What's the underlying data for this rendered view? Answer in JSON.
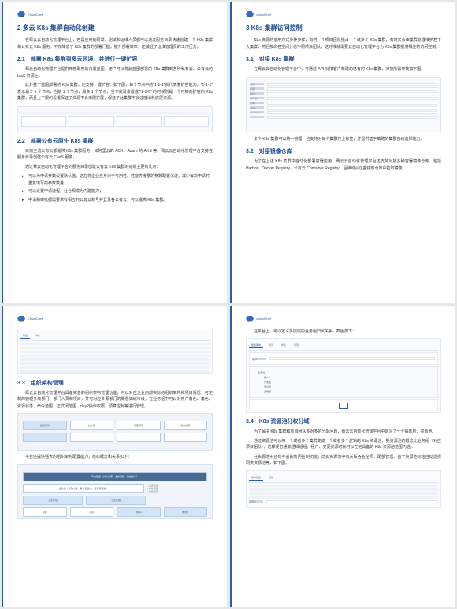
{
  "brand": "CloudChef",
  "page1": {
    "h1": "2 多云 K8s 集群自动化创建",
    "p1": "在骞云云自动化管理平台上，容器应用的研发、测试和运维人员都可以通过服务目录快速创建一个 K8s 集群和公有云 K8s 服务。不仅降低了 K8s 集群的部署门槛，提升部署效率，还减轻了运维管理员的工作压力。",
    "h2a": "2.1　部署 K8s 集群到多云环境，并进行一键扩容",
    "p2": "骞云自动化管理平台提供开箱即用的内置蓝图，用户可以将此蓝图部署的 K8s 集群到各种私有云、公有云的 IaaS 资源上。",
    "p3": "此外基于蓝图部署的 K8s 集群，还支持一键扩容。如下图，每个节点中的\"1-1-1\"就代表着扩容能力，\"1-1-1\" 表示最少 1 个节点，当前 1 个节点，最多 1 个节点，当下就没设置成 \"1-2-6\" 的时候则是一个可横向扩容的 K8s 集群，而且上下限的设置保证了资源不会无限扩展，保证了此集群不会过度消耗底层资源。",
    "h2b": "2.2　部署公有云原生 K8s 集群",
    "p4": "目前主流公有云都提供 K8s 集群服务，如阿里云的 ACK，Azure 的 AKS 等。骞云云自动化管理平台支持在服务目录创建公有云 CaaS 服务。",
    "p5": "通过骞云自动化管理平台的服务目录创建公有云 K8s 集群的好处主要有几点：",
    "bullets": [
      "可以为申请参数设置默认值，这在将企业自身对于可用性、性能等考量的参数配置沉淀，减少每次申请时重复填写的参数数量；",
      "可以设置申请流程，让合规成为内建能力；",
      "申请和审批都需要求有相应的公有云账号并登录各公有云，可以提高 K8s 集群。"
    ]
  },
  "page2": {
    "h1": "3 K8s 集群访问控制",
    "p1": "K8s 资源的使用方式多种多样，有时一个项目团队独占一个或多个 K8s 集群，有时又会由集群管理维护若干大集群，然后按命名空间分给不同项目团队，这时候就需要云自动化管理平台为 K8s 集群提供相应的访问控制。",
    "h2a": "3.1　对接 K8s 集群",
    "p2": "在骞云云自动化管理平台中，可通过 API 对接客户新建的已有的 K8s 集群，对接所需参数如下图。",
    "p3": "多个 K8s 集群可以统一管理，也支持对每个集群打上标签，并提供基于策略的集群自动选择能力。",
    "h2b": "3.2　对接镜像仓库",
    "p4": "为了在上述 K8s 集群中自动化部署容器应用，骞云云自动化管理平台还支持对接多种容器镜像仓库，包括 Harbor，Docker Registry，公有云 Container Registry。后续可从这些镜像仓库中拉取镜像。",
    "form_labels": [
      "名称",
      "类型",
      "地址",
      "用户名",
      "密码",
      "Token",
      "Namespace"
    ]
  },
  "page3": {
    "h2a": "3.3　组织架构管理",
    "p1": "骞云云自动化管理平台具备完善的组织架构管理功能，可以对应企业内部实际的组织架构和项目情况，可定制的管理多级部门、部门人员和项目，并可对应多源部门的概念如城市级，在业务组中可以对用户角色、角色、资源状态、命令范围、正式闭范围、day2操作权限，预算控制等进行管理。",
    "p2": "平台还提供强大的组织架构配置能力，核心概念和关系如下：",
    "diag_labels": [
      "平台配置（共享资源、业务流程、角色定义）",
      "业务组（资源内容、审计和运维，组件有哪些）",
      "子业务组",
      "项目",
      "项目",
      "角色A",
      "角色B"
    ]
  },
  "page4": {
    "p1": "在平台上，可以定义多层层的业务组归属关系，截图如下：",
    "h2a": "3.4　K8s 资源池分权分域",
    "p2": "为了解决 K8s 集群和项目团队多对多的分配问题，骞云云自动化管理平台中定义了一个抽象层：资源池。",
    "p3": "通过资源池可以将一个或者多个集群变成一个或者多个逻辑的 K8s 资源池，把资源池的概念比业务组（对应项目团队），这样便打通非逻辑组组、租户、变更资源时就可以在他具备的 K8s 资源池范围内选).",
    "p4": "在资源池中还有丰富的访问控制功能，比如资源池中有关联各名空间、配额管理、基于资源池标签自动选择同类资源池等，如下图。",
    "tree": [
      "业务组",
      "租户A",
      "开发组",
      "测试组",
      "运维组"
    ]
  }
}
